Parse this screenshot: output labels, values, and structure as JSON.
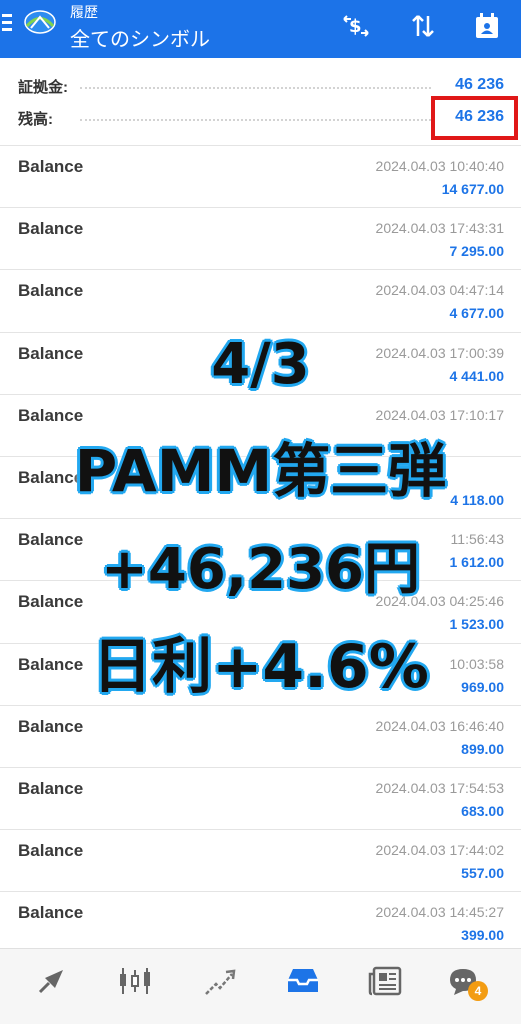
{
  "header": {
    "subtitle": "履歴",
    "title": "全てのシンボル",
    "icons": [
      "menu-icon",
      "app-logo",
      "dollar-swap-icon",
      "sort-icon",
      "period-calendar-icon"
    ]
  },
  "summary": {
    "deposit_label": "証拠金:",
    "deposit_value": "46 236",
    "balance_label": "残高:",
    "balance_value": "46 236"
  },
  "deals": [
    {
      "name": "Balance",
      "time": "2024.04.03 10:40:40",
      "profit": "14 677.00"
    },
    {
      "name": "Balance",
      "time": "2024.04.03 17:43:31",
      "profit": "7 295.00"
    },
    {
      "name": "Balance",
      "time": "2024.04.03 04:47:14",
      "profit": "4 677.00"
    },
    {
      "name": "Balance",
      "time": "2024.04.03 17:00:39",
      "profit": "4 441.00"
    },
    {
      "name": "Balance",
      "time": "2024.04.03 17:10:17",
      "profit": ""
    },
    {
      "name": "Balance",
      "time": "",
      "profit": "4 118.00"
    },
    {
      "name": "Balance",
      "time": "11:56:43",
      "profit": "1 612.00"
    },
    {
      "name": "Balance",
      "time": "2024.04.03 04:25:46",
      "profit": "1 523.00"
    },
    {
      "name": "Balance",
      "time": "10:03:58",
      "profit": "969.00"
    },
    {
      "name": "Balance",
      "time": "2024.04.03 16:46:40",
      "profit": "899.00"
    },
    {
      "name": "Balance",
      "time": "2024.04.03 17:54:53",
      "profit": "683.00"
    },
    {
      "name": "Balance",
      "time": "2024.04.03 17:44:02",
      "profit": "557.00"
    },
    {
      "name": "Balance",
      "time": "2024.04.03 14:45:27",
      "profit": "399.00"
    }
  ],
  "overlay": {
    "line1": "4/3",
    "line2": "PAMM第三弾",
    "line3": "+46,236円",
    "line4": "日利+4.6%"
  },
  "bottom_nav": {
    "items": [
      "quotes-icon",
      "chart-icon",
      "trade-icon",
      "history-icon",
      "news-icon",
      "chat-icon"
    ],
    "active": "history-icon",
    "chat_badge": "4"
  },
  "colors": {
    "header_bg": "#1c73e8",
    "value_blue": "#1d74e7",
    "highlight_red": "#e01818",
    "overlay_outline": "#22a8f0"
  }
}
